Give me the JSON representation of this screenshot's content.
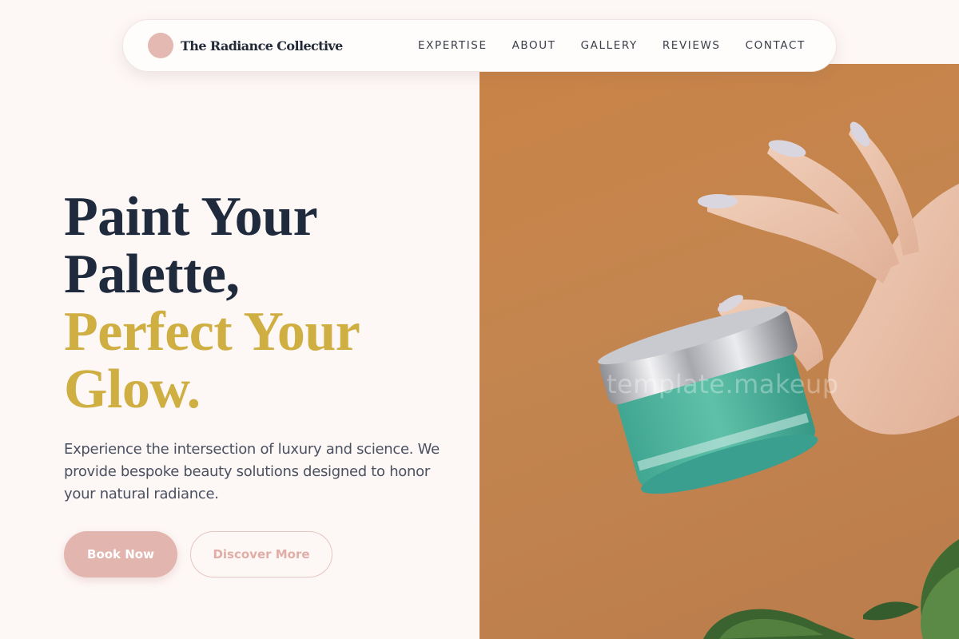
{
  "brand": {
    "name": "The Radiance Collective"
  },
  "nav": {
    "items": [
      {
        "label": "EXPERTISE"
      },
      {
        "label": "ABOUT"
      },
      {
        "label": "GALLERY"
      },
      {
        "label": "REVIEWS"
      },
      {
        "label": "CONTACT"
      }
    ]
  },
  "hero": {
    "headline_line1": "Paint Your",
    "headline_line2": "Palette,",
    "headline_line3": "Perfect Your",
    "headline_line4": "Glow.",
    "subtext": "Experience the intersection of luxury and science. We provide bespoke beauty solutions designed to honor your natural radiance.",
    "primary_button": "Book Now",
    "secondary_button": "Discover More",
    "image_watermark": "template.makeup"
  },
  "colors": {
    "background": "#fdf7f6",
    "accent_pink": "#e2b6ae",
    "accent_gold": "#cfae42",
    "headline_dark": "#1f2a3d",
    "image_bg": "#c3854f"
  }
}
